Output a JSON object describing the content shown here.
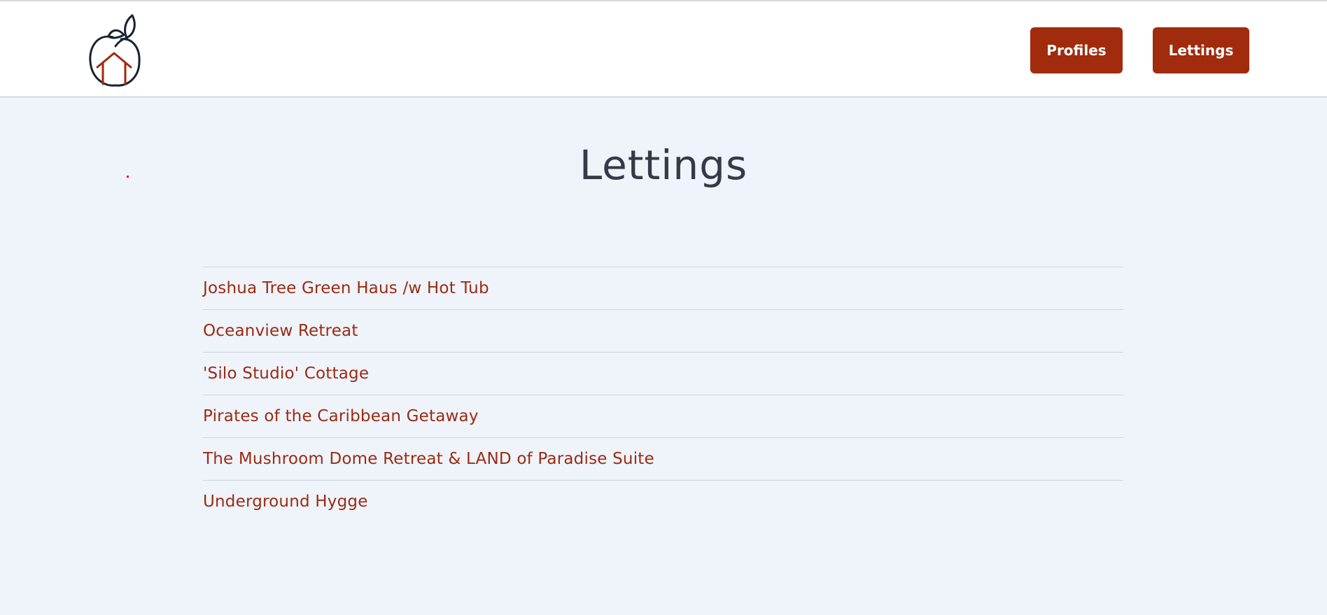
{
  "header": {
    "logo_icon": "house-in-apple-logo-icon",
    "nav": {
      "profiles_label": "Profiles",
      "lettings_label": "Lettings"
    }
  },
  "main": {
    "title": "Lettings",
    "lettings": [
      {
        "label": "Joshua Tree Green Haus /w Hot Tub"
      },
      {
        "label": "Oceanview Retreat"
      },
      {
        "label": "'Silo Studio' Cottage"
      },
      {
        "label": "Pirates of the Caribbean Getaway"
      },
      {
        "label": "The Mushroom Dome Retreat & LAND of Paradise Suite"
      },
      {
        "label": "Underground Hygge"
      }
    ]
  },
  "colors": {
    "accent": "#a12b0d",
    "link": "#9a2b12",
    "background": "#eff3fa",
    "title": "#343a46"
  }
}
